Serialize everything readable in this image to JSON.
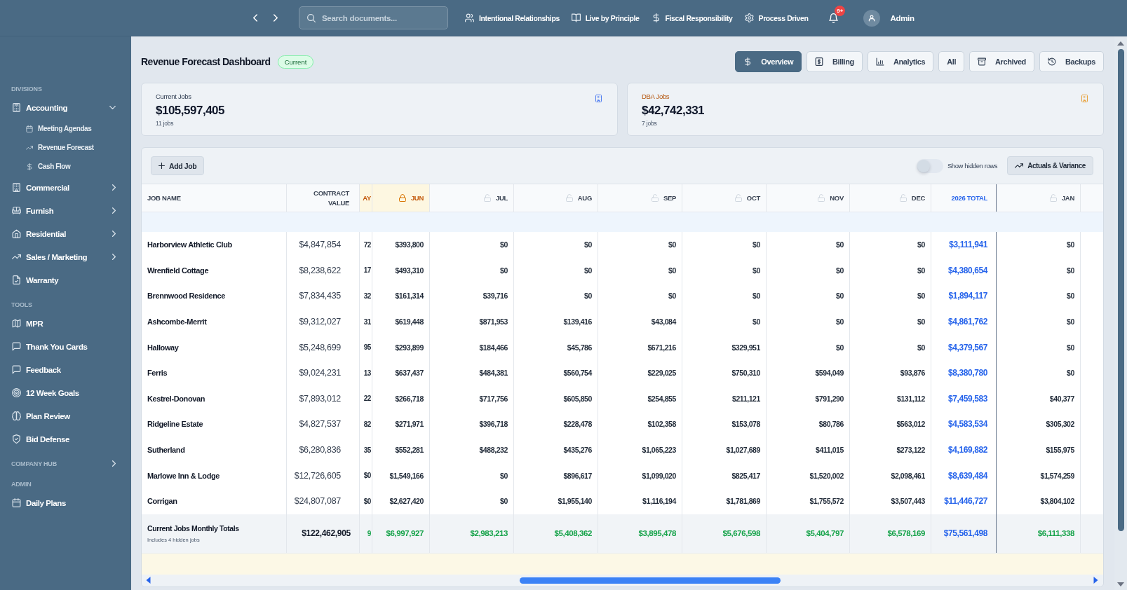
{
  "topbar": {
    "search": {
      "placeholder": "Search documents..."
    },
    "links": [
      {
        "label": "Intentional Relationships"
      },
      {
        "label": "Live by Principle"
      },
      {
        "label": "Fiscal Responsibility"
      },
      {
        "label": "Process Driven"
      }
    ],
    "notifications": {
      "badge": "9+"
    },
    "user": {
      "name": "Admin"
    }
  },
  "sidebar": {
    "sections": [
      {
        "title": "DIVISIONS",
        "kind": "plain",
        "items": [
          {
            "label": "Accounting",
            "kind": "group",
            "expanded": true,
            "children": [
              {
                "label": "Meeting Agendas"
              },
              {
                "label": "Revenue Forecast"
              },
              {
                "label": "Cash Flow"
              }
            ]
          },
          {
            "label": "Commercial",
            "kind": "group",
            "expanded": false
          },
          {
            "label": "Furnish",
            "kind": "group",
            "expanded": false
          },
          {
            "label": "Residential",
            "kind": "group",
            "expanded": false
          },
          {
            "label": "Sales / Marketing",
            "kind": "group",
            "expanded": false
          },
          {
            "label": "Warranty",
            "kind": "link"
          }
        ]
      },
      {
        "title": "TOOLS",
        "kind": "plain",
        "items": [
          {
            "label": "MPR",
            "kind": "link"
          },
          {
            "label": "Thank You Cards",
            "kind": "link"
          },
          {
            "label": "Feedback",
            "kind": "link"
          },
          {
            "label": "12 Week Goals",
            "kind": "link"
          },
          {
            "label": "Plan Review",
            "kind": "link"
          },
          {
            "label": "Bid Defense",
            "kind": "link"
          }
        ]
      },
      {
        "title": "COMPANY HUB",
        "kind": "collapsible",
        "expanded": false
      },
      {
        "title": "ADMIN",
        "kind": "plain",
        "items": [
          {
            "label": "Daily Plans",
            "kind": "link"
          }
        ]
      }
    ]
  },
  "page": {
    "title": "Revenue Forecast Dashboard",
    "status": "Current",
    "tabs": [
      {
        "label": "Overview",
        "selected": true
      },
      {
        "label": "Billing",
        "selected": false
      },
      {
        "label": "Analytics",
        "selected": false
      },
      {
        "label": "All",
        "selected": false
      },
      {
        "label": "Archived",
        "selected": false
      },
      {
        "label": "Backups",
        "selected": false
      }
    ]
  },
  "summary_cards": [
    {
      "label": "Current Jobs",
      "value": "$105,597,405",
      "count": "11 jobs",
      "kind": "plain",
      "color": "#4f7df0"
    },
    {
      "label": "DBA Jobs",
      "value": "$42,742,331",
      "count": "7 jobs",
      "kind": "accent",
      "color": "#e8a13a"
    }
  ],
  "table": {
    "toolbar": {
      "add_button": {
        "label": "Add Job"
      },
      "toggle": {
        "label": "Show hidden rows",
        "on": false
      },
      "actuals_button": {
        "label": "Actuals & Variance"
      }
    },
    "columns": [
      {
        "label": "JOB NAME",
        "kind": "name"
      },
      {
        "label": "CONTRACT VALUE",
        "kind": "contract"
      },
      {
        "label": "AY",
        "kind": "partial",
        "locked": true
      },
      {
        "label": "JUN",
        "kind": "month",
        "locked": true
      },
      {
        "label": "JUL",
        "kind": "month",
        "locked": false
      },
      {
        "label": "AUG",
        "kind": "month",
        "locked": false
      },
      {
        "label": "SEP",
        "kind": "month",
        "locked": false
      },
      {
        "label": "OCT",
        "kind": "month",
        "locked": false
      },
      {
        "label": "NOV",
        "kind": "month",
        "locked": false
      },
      {
        "label": "DEC",
        "kind": "month",
        "locked": false
      },
      {
        "label": "2026 TOTAL",
        "kind": "total"
      },
      {
        "label": "JAN",
        "kind": "month",
        "locked": false
      }
    ],
    "rows": [
      {
        "cells": [
          "Harborview Athletic Club",
          "$4,847,854",
          "72",
          "$393,800",
          "$0",
          "$0",
          "$0",
          "$0",
          "$0",
          "$0",
          "$3,111,941",
          "$0"
        ]
      },
      {
        "cells": [
          "Wrenfield Cottage",
          "$8,238,622",
          "17",
          "$493,310",
          "$0",
          "$0",
          "$0",
          "$0",
          "$0",
          "$0",
          "$4,380,654",
          "$0"
        ]
      },
      {
        "cells": [
          "Brennwood Residence",
          "$7,834,435",
          "32",
          "$161,314",
          "$39,716",
          "$0",
          "$0",
          "$0",
          "$0",
          "$0",
          "$1,894,117",
          "$0"
        ]
      },
      {
        "cells": [
          "Ashcombe-Merrit",
          "$9,312,027",
          "31",
          "$619,448",
          "$871,953",
          "$139,416",
          "$43,084",
          "$0",
          "$0",
          "$0",
          "$4,861,762",
          "$0"
        ]
      },
      {
        "cells": [
          "Halloway",
          "$5,248,699",
          "95",
          "$293,899",
          "$184,466",
          "$45,786",
          "$671,216",
          "$329,951",
          "$0",
          "$0",
          "$4,379,567",
          "$0"
        ]
      },
      {
        "cells": [
          "Ferris",
          "$9,024,231",
          "13",
          "$637,437",
          "$484,381",
          "$560,754",
          "$229,025",
          "$750,310",
          "$594,049",
          "$93,876",
          "$8,380,780",
          "$0"
        ]
      },
      {
        "cells": [
          "Kestrel-Donovan",
          "$7,893,012",
          "22",
          "$266,718",
          "$717,756",
          "$605,850",
          "$254,855",
          "$211,121",
          "$791,290",
          "$131,112",
          "$7,459,583",
          "$40,377"
        ]
      },
      {
        "cells": [
          "Ridgeline Estate",
          "$4,827,537",
          "82",
          "$271,971",
          "$396,718",
          "$228,478",
          "$102,358",
          "$153,078",
          "$80,786",
          "$563,012",
          "$4,583,534",
          "$305,302"
        ]
      },
      {
        "cells": [
          "Sutherland",
          "$6,280,836",
          "35",
          "$552,281",
          "$488,232",
          "$435,276",
          "$1,065,223",
          "$1,027,689",
          "$411,015",
          "$273,122",
          "$4,169,882",
          "$155,975"
        ]
      },
      {
        "cells": [
          "Marlowe Inn & Lodge",
          "$12,726,605",
          "$0",
          "$1,549,166",
          "$0",
          "$896,617",
          "$1,099,020",
          "$825,417",
          "$1,520,002",
          "$2,098,461",
          "$8,639,484",
          "$1,574,259"
        ]
      },
      {
        "cells": [
          "Corrigan",
          "$24,807,087",
          "$0",
          "$2,627,420",
          "$0",
          "$1,955,140",
          "$1,116,194",
          "$1,781,869",
          "$1,755,572",
          "$3,507,443",
          "$11,446,727",
          "$3,804,102"
        ]
      }
    ],
    "totals": {
      "cells": [
        "Current Jobs Monthly Totals",
        "$122,462,905",
        "9",
        "$6,997,927",
        "$2,983,213",
        "$5,408,362",
        "$3,895,478",
        "$5,676,598",
        "$5,404,797",
        "$6,578,169",
        "$75,561,498",
        "$6,111,338"
      ],
      "note": "Includes 4 hidden jobs"
    }
  }
}
